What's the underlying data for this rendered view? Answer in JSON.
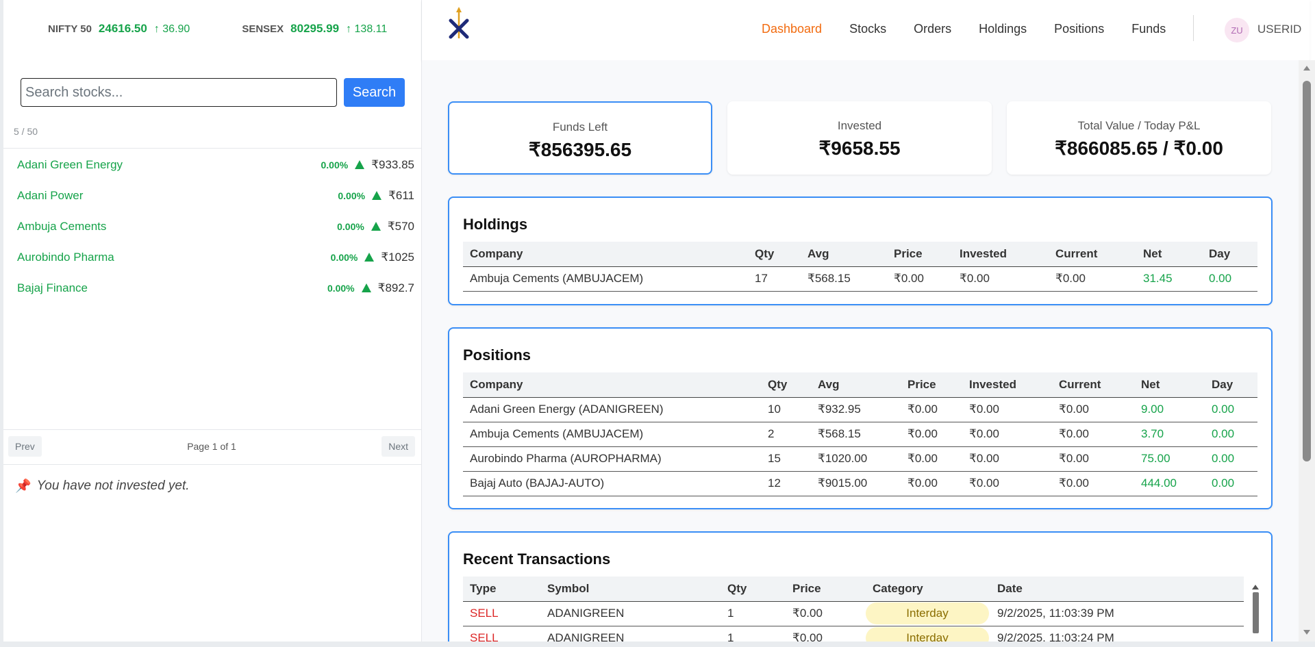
{
  "indices": [
    {
      "name": "NIFTY 50",
      "value": "24616.50",
      "change": "↑ 36.90"
    },
    {
      "name": "SENSEX",
      "value": "80295.99",
      "change": "↑ 138.11"
    }
  ],
  "search": {
    "placeholder": "Search stocks...",
    "button": "Search",
    "count": "5 / 50"
  },
  "stocks": [
    {
      "name": "Adani Green Energy",
      "pct": "0.00%",
      "price": "₹933.85"
    },
    {
      "name": "Adani Power",
      "pct": "0.00%",
      "price": "₹611"
    },
    {
      "name": "Ambuja Cements",
      "pct": "0.00%",
      "price": "₹570"
    },
    {
      "name": "Aurobindo Pharma",
      "pct": "0.00%",
      "price": "₹1025"
    },
    {
      "name": "Bajaj Finance",
      "pct": "0.00%",
      "price": "₹892.7"
    }
  ],
  "pager": {
    "prev": "Prev",
    "label": "Page 1 of 1",
    "next": "Next"
  },
  "note": "You have not invested yet.",
  "nav": {
    "items": [
      "Dashboard",
      "Stocks",
      "Orders",
      "Holdings",
      "Positions",
      "Funds"
    ],
    "active": "Dashboard",
    "avatar": "ZU",
    "user": "USERID"
  },
  "stats": [
    {
      "label": "Funds Left",
      "value": "₹856395.65"
    },
    {
      "label": "Invested",
      "value": "₹9658.55"
    },
    {
      "label": "Total Value / Today P&L",
      "value": "₹866085.65 / ₹0.00"
    }
  ],
  "holdings": {
    "title": "Holdings",
    "headers": [
      "Company",
      "Qty",
      "Avg",
      "Price",
      "Invested",
      "Current",
      "Net",
      "Day"
    ],
    "rows": [
      [
        "Ambuja Cements (AMBUJACEM)",
        "17",
        "₹568.15",
        "₹0.00",
        "₹0.00",
        "₹0.00",
        "31.45",
        "0.00"
      ]
    ]
  },
  "positions": {
    "title": "Positions",
    "headers": [
      "Company",
      "Qty",
      "Avg",
      "Price",
      "Invested",
      "Current",
      "Net",
      "Day"
    ],
    "rows": [
      [
        "Adani Green Energy (ADANIGREEN)",
        "10",
        "₹932.95",
        "₹0.00",
        "₹0.00",
        "₹0.00",
        "9.00",
        "0.00"
      ],
      [
        "Ambuja Cements (AMBUJACEM)",
        "2",
        "₹568.15",
        "₹0.00",
        "₹0.00",
        "₹0.00",
        "3.70",
        "0.00"
      ],
      [
        "Aurobindo Pharma (AUROPHARMA)",
        "15",
        "₹1020.00",
        "₹0.00",
        "₹0.00",
        "₹0.00",
        "75.00",
        "0.00"
      ],
      [
        "Bajaj Auto (BAJAJ-AUTO)",
        "12",
        "₹9015.00",
        "₹0.00",
        "₹0.00",
        "₹0.00",
        "444.00",
        "0.00"
      ]
    ]
  },
  "transactions": {
    "title": "Recent Transactions",
    "headers": [
      "Type",
      "Symbol",
      "Qty",
      "Price",
      "Category",
      "Date"
    ],
    "rows": [
      [
        "SELL",
        "ADANIGREEN",
        "1",
        "₹0.00",
        "Interday",
        "9/2/2025, 11:03:39 PM"
      ],
      [
        "SELL",
        "ADANIGREEN",
        "1",
        "₹0.00",
        "Interday",
        "9/2/2025, 11:03:24 PM"
      ]
    ]
  },
  "colors": {
    "accent": "#3a8ef6",
    "active_nav": "#f26b0f",
    "gain": "#16a34a",
    "sell": "#dc2626"
  }
}
